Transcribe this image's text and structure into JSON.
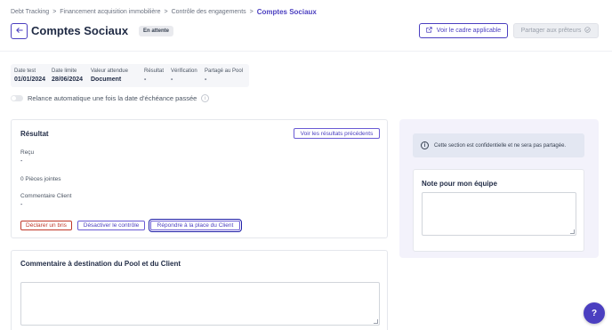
{
  "breadcrumb": {
    "items": [
      "Debt Tracking",
      "Financement acquisition immobilière",
      "Contrôle des engagements"
    ],
    "current": "Comptes Sociaux",
    "separator": ">"
  },
  "header": {
    "back_icon": "arrow-left-icon",
    "title": "Comptes Sociaux",
    "status_badge": "En attente",
    "cadre_button": "Voir le cadre applicable",
    "share_button": "Partager aux prêteurs"
  },
  "info": {
    "columns": [
      {
        "label": "Date test",
        "value": "01/01/2024"
      },
      {
        "label": "Date limite",
        "value": "28/06/2024"
      },
      {
        "label": "Valeur attendue",
        "value": "Document"
      },
      {
        "label": "Résultat",
        "value": "-"
      },
      {
        "label": "Vérification",
        "value": "-"
      },
      {
        "label": "Partagé au Pool",
        "value": "-"
      }
    ]
  },
  "toggle": {
    "label": "Relance automatique une fois la date d'échéance passée",
    "enabled": false
  },
  "result_card": {
    "title": "Résultat",
    "previous_button": "Voir les résultats précédents",
    "received_label": "Reçu",
    "received_value": "-",
    "attachments": "0 Pièces jointes",
    "client_comment_label": "Commentaire Client",
    "client_comment_value": "-",
    "breach_button": "Déclarer un bris",
    "deactivate_button": "Désactiver le contrôle",
    "answer_button": "Répondre à la place du Client"
  },
  "comment_card": {
    "title": "Commentaire à destination du Pool et du Client",
    "value": ""
  },
  "side_panel": {
    "notice": "Cette section est confidentielle et ne sera pas partagée.",
    "note_title": "Note pour mon équipe",
    "note_value": ""
  },
  "help": {
    "label": "?"
  },
  "colors": {
    "accent": "#4b3fc0",
    "danger": "#c0392b",
    "panel": "#f3f2fb"
  }
}
